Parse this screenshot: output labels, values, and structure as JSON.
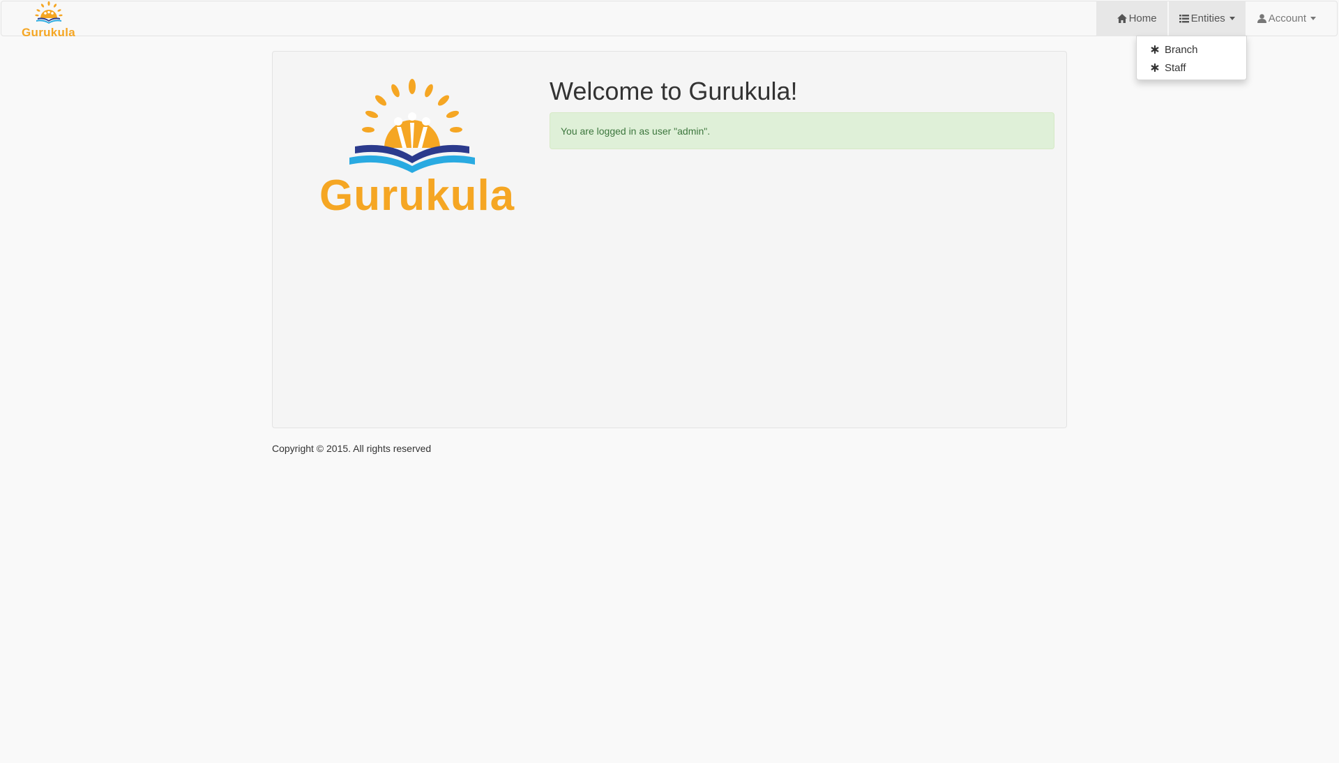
{
  "navbar": {
    "brand_text": "Gurukula",
    "items": [
      {
        "label": "Home",
        "icon": "home-icon"
      },
      {
        "label": "Entities",
        "icon": "list-icon",
        "active": true,
        "dropdown": true
      },
      {
        "label": "Account",
        "icon": "user-icon",
        "dropdown": true
      }
    ]
  },
  "entities_menu": {
    "items": [
      {
        "label": "Branch",
        "icon": "asterisk-icon"
      },
      {
        "label": "Staff",
        "icon": "asterisk-icon"
      }
    ]
  },
  "main": {
    "logo_text": "Gurukula",
    "title": "Welcome to Gurukula!",
    "alert": "You are logged in as user \"admin\"."
  },
  "footer": {
    "copyright": "Copyright © 2015. All rights reserved"
  },
  "colors": {
    "brand_orange": "#f5a623",
    "book_dark_blue": "#2b3a8c",
    "book_light_blue": "#29aae1",
    "alert_bg": "#dff0d8",
    "alert_text": "#3c763d",
    "navbar_active_bg": "#e7e7e7"
  }
}
